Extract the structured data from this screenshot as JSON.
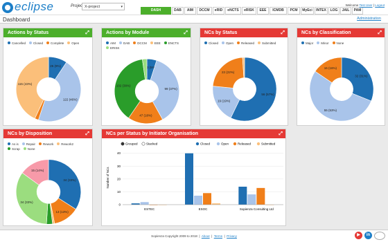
{
  "app": {
    "logo": "eclipse",
    "project_label": "Project:",
    "project_value": "X-project"
  },
  "nav": {
    "tabs": [
      "DASH",
      "DAB",
      "AIM",
      "DCCM",
      "eRID",
      "eNCTS",
      "eRISK",
      "EEE",
      "ICMDB",
      "PCM",
      "MyEci",
      "INTEX",
      "LOG",
      "JAIL",
      "PAM"
    ],
    "active": "DASH"
  },
  "header": {
    "welcome": "Welcome",
    "user": "Test User",
    "separator": "|",
    "logout": "Logout",
    "page_title": "Dashboard",
    "admin_link": "Administration"
  },
  "colors": {
    "green": "#4caf2b",
    "red": "#e53935",
    "blue": "#1f6fb2",
    "light_blue": "#a9c4ea",
    "orange": "#f07f1a",
    "peach": "#fbbf7a",
    "dkgreen": "#2a9d2a",
    "pink": "#f79aa9",
    "lightgreen": "#9bdd7f"
  },
  "panels": [
    {
      "id": "actions-status",
      "title": "Actions by Status",
      "color": "green",
      "chart_data": {
        "type": "pie",
        "donut": true,
        "legend": "top",
        "series": [
          {
            "name": "Cancelled",
            "color": "#1f6fb2",
            "value": 25,
            "label": "25 (9%)"
          },
          {
            "name": "Closed",
            "color": "#a9c4ea",
            "value": 122,
            "label": "122 (46%)"
          },
          {
            "name": "Complete",
            "color": "#f07f1a",
            "value": 5,
            "label": ""
          },
          {
            "name": "Open",
            "color": "#fbbf7a",
            "value": 115,
            "label": "115 (43%)"
          }
        ]
      }
    },
    {
      "id": "actions-module",
      "title": "Actions by Module",
      "color": "green",
      "chart_data": {
        "type": "pie",
        "donut": true,
        "legend": "top",
        "series": [
          {
            "name": "AIM",
            "color": "#1f6fb2",
            "value": 13,
            "label": "13 (5%)"
          },
          {
            "name": "DAB",
            "color": "#a9c4ea",
            "value": 99,
            "label": "99 (37%)"
          },
          {
            "name": "DCCM",
            "color": "#f07f1a",
            "value": 47,
            "label": "47 (18%)"
          },
          {
            "name": "EEE",
            "color": "#fbbf7a",
            "value": 0,
            "label": ""
          },
          {
            "name": "ENCTS",
            "color": "#2a9d2a",
            "value": 102,
            "label": "102 (38%)"
          },
          {
            "name": "ERISK",
            "color": "#9bdd7f",
            "value": 6,
            "label": ""
          }
        ]
      }
    },
    {
      "id": "ncs-status",
      "title": "NCs by Status",
      "color": "red",
      "chart_data": {
        "type": "pie",
        "donut": true,
        "legend": "top",
        "series": [
          {
            "name": "Closed",
            "color": "#1f6fb2",
            "value": 56,
            "label": "56 (57%)"
          },
          {
            "name": "Open",
            "color": "#a9c4ea",
            "value": 19,
            "label": "19 (19%)"
          },
          {
            "name": "Released",
            "color": "#f07f1a",
            "value": 22,
            "label": "22 (22%)"
          },
          {
            "name": "Submitted",
            "color": "#fbbf7a",
            "value": 1,
            "label": ""
          }
        ]
      }
    },
    {
      "id": "ncs-class",
      "title": "NCs by Classification",
      "color": "red",
      "chart_data": {
        "type": "pie",
        "donut": true,
        "legend": "top",
        "series": [
          {
            "name": "Major",
            "color": "#1f6fb2",
            "value": 32,
            "label": "32 (31%)"
          },
          {
            "name": "Minor",
            "color": "#a9c4ea",
            "value": 55,
            "label": "55 (53%)"
          },
          {
            "name": "None",
            "color": "#f07f1a",
            "value": 16,
            "label": "16 (16%)"
          }
        ]
      }
    },
    {
      "id": "ncs-disp",
      "title": "NCs by Disposition",
      "color": "red",
      "chart_data": {
        "type": "pie",
        "donut": true,
        "legend": "top",
        "series": [
          {
            "name": "As is",
            "color": "#1f6fb2",
            "value": 34,
            "label": "34 (33%)"
          },
          {
            "name": "Repair",
            "color": "#a9c4ea",
            "value": 0,
            "label": ""
          },
          {
            "name": "Rework",
            "color": "#f07f1a",
            "value": 13,
            "label": "13 (13%)"
          },
          {
            "name": "Rework2",
            "color": "#fbbf7a",
            "value": 1,
            "label": ""
          },
          {
            "name": "Scrap",
            "color": "#2a9d2a",
            "value": 3,
            "label": ""
          },
          {
            "name": "None",
            "color": "#9bdd7f",
            "value": 34,
            "label": "34 (33%)"
          },
          {
            "name": "",
            "color": "#f79aa9",
            "value": 15,
            "label": "15 (14%)"
          }
        ]
      }
    }
  ],
  "bar_panel": {
    "title": "NCs per Status by Initiator Organisation",
    "toggle": [
      {
        "label": "Grouped",
        "on": true
      },
      {
        "label": "Stacked",
        "on": false
      }
    ],
    "chart_data": {
      "type": "bar",
      "categories": [
        "ESTEC",
        "ESOC",
        "Sopienza Consulting Ltd"
      ],
      "ylabel": "Number of NCs",
      "yticks": [
        0,
        10,
        20,
        30,
        40
      ],
      "ylim": [
        0,
        42
      ],
      "series": [
        {
          "name": "Closed",
          "color": "#1f6fb2",
          "values": [
            1,
            40,
            14
          ]
        },
        {
          "name": "Open",
          "color": "#a9c4ea",
          "values": [
            2,
            7,
            8
          ]
        },
        {
          "name": "Released",
          "color": "#f07f1a",
          "values": [
            0,
            9,
            13
          ]
        },
        {
          "name": "Submitted",
          "color": "#fbbf7a",
          "values": [
            0,
            1,
            0
          ]
        }
      ]
    }
  },
  "footer": {
    "copyright": "Sopienza Copyright 2009 to 2018",
    "about": "About",
    "terms": "Terms",
    "privacy": "Privacy",
    "sep": "|"
  }
}
